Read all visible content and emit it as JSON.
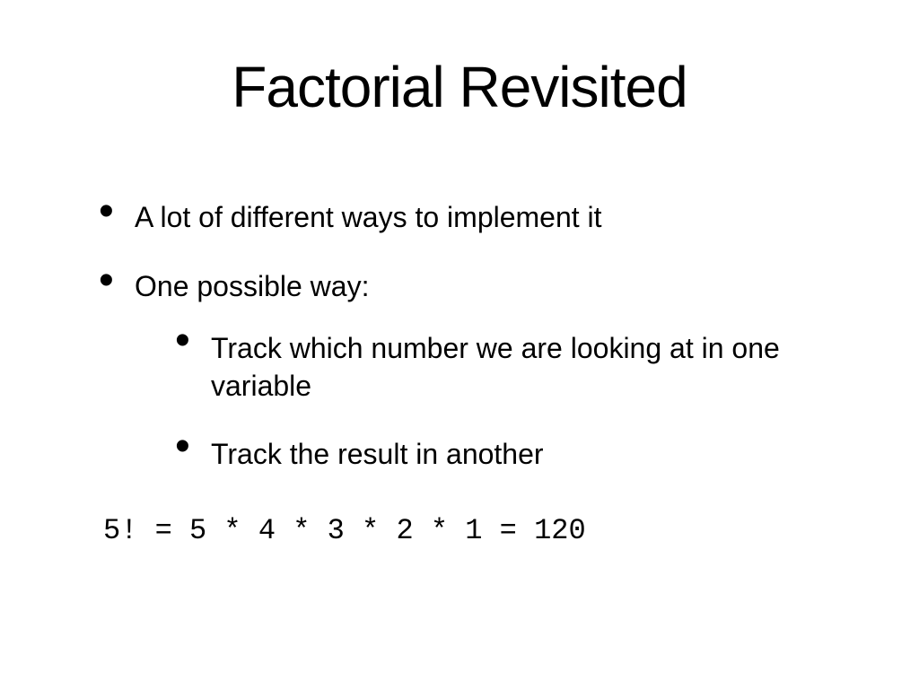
{
  "title": "Factorial Revisited",
  "bullets": [
    {
      "text": "A lot of different ways to implement it"
    },
    {
      "text": "One possible way:",
      "children": [
        "Track which number we are looking at in one variable",
        "Track the result in another"
      ]
    }
  ],
  "code": "5! = 5 * 4 * 3 * 2 * 1 = 120"
}
